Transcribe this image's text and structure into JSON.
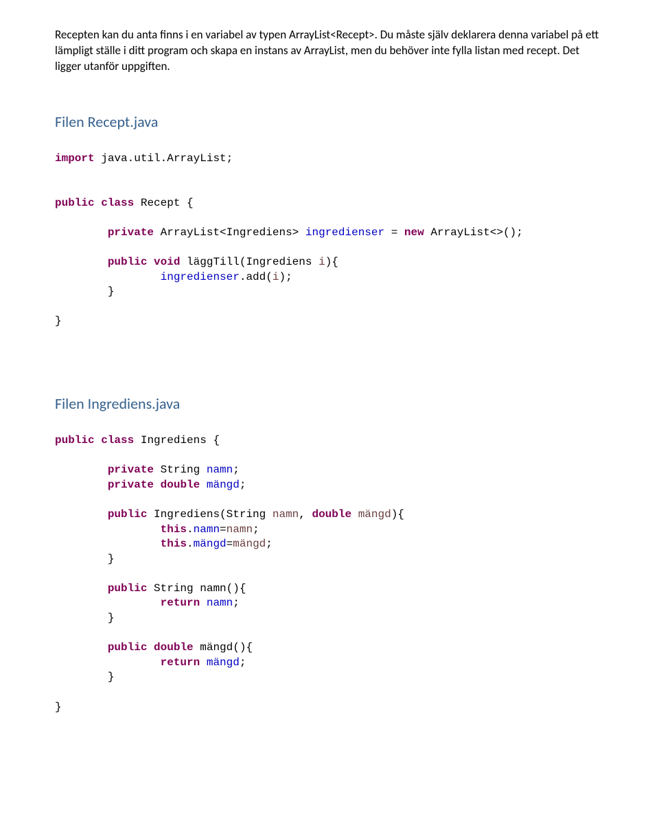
{
  "intro": {
    "p1": "Recepten kan du anta finns i en variabel av typen ArrayList<Recept>. Du måste själv deklarera denna variabel på ett lämpligt ställe i ditt program och skapa en instans av ArrayList, men du behöver inte fylla listan med recept. Det ligger utanför uppgiften."
  },
  "recept": {
    "heading": "Filen Recept.java",
    "line1_kw1": "import",
    "line1_rest": " java.util.ArrayList;",
    "line2_kw1": "public",
    "line2_kw2": "class",
    "line2_rest": " Recept {",
    "line3_kw1": "private",
    "line3_plain1": " ArrayList<Ingrediens> ",
    "line3_field": "ingredienser",
    "line3_plain2": " = ",
    "line3_kw2": "new",
    "line3_plain3": " ArrayList<>();",
    "line4_kw1": "public",
    "line4_kw2": "void",
    "line4_plain1": " läggTill(Ingrediens ",
    "line4_var": "i",
    "line4_plain2": "){",
    "line5_field": "ingredienser",
    "line5_plain1": ".add(",
    "line5_var": "i",
    "line5_plain2": ");",
    "close_brace": "}"
  },
  "ingrediens": {
    "heading": "Filen Ingrediens.java",
    "line1_kw1": "public",
    "line1_kw2": "class",
    "line1_rest": " Ingrediens {",
    "line2_kw1": "private",
    "line2_plain1": " String ",
    "line2_field": "namn",
    "line2_plain2": ";",
    "line3_kw1": "private",
    "line3_kw2": "double",
    "line3_field": "mängd",
    "line3_plain": ";",
    "line4_kw1": "public",
    "line4_plain1": " Ingrediens(String ",
    "line4_var1": "namn",
    "line4_plain2": ", ",
    "line4_kw2": "double",
    "line4_plain3": " ",
    "line4_var2": "mängd",
    "line4_plain4": "){",
    "line5_kw": "this",
    "line5_plain1": ".",
    "line5_field": "namn",
    "line5_plain2": "=",
    "line5_var": "namn",
    "line5_plain3": ";",
    "line6_kw": "this",
    "line6_plain1": ".",
    "line6_field": "mängd",
    "line6_plain2": "=",
    "line6_var": "mängd",
    "line6_plain3": ";",
    "line7_kw1": "public",
    "line7_plain1": " String namn(){",
    "line8_kw": "return",
    "line8_field": "namn",
    "line8_plain": ";",
    "line9_kw1": "public",
    "line9_kw2": "double",
    "line9_plain1": " mängd(){",
    "line10_kw": "return",
    "line10_field": "mängd",
    "line10_plain": ";"
  }
}
